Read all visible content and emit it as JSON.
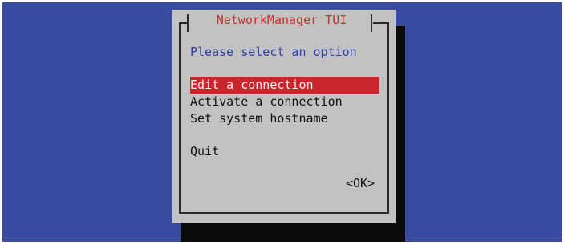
{
  "dialog": {
    "title": "NetworkManager TUI",
    "prompt": "Please select an option",
    "menu": [
      "Edit a connection",
      "Activate a connection",
      "Set system hostname"
    ],
    "quit": "Quit",
    "ok_label": "<OK>",
    "selected_index": 0
  },
  "colors": {
    "background": "#3a4ca0",
    "dialog": "#c2c2c2",
    "title": "#c0312b",
    "prompt": "#2b3fa8",
    "selection": "#c9262e"
  }
}
